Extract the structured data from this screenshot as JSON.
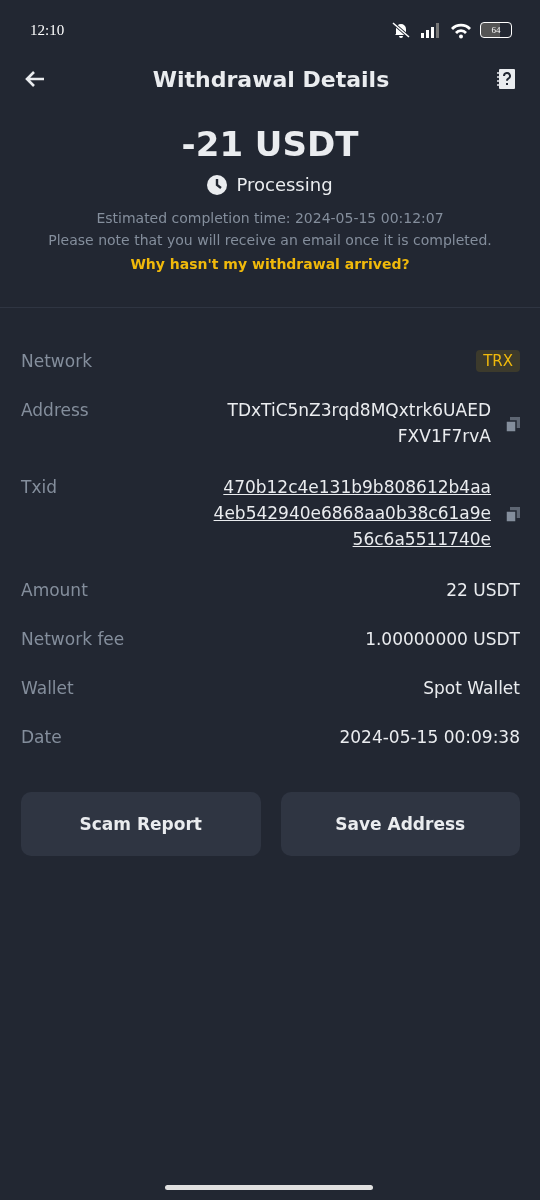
{
  "status_bar": {
    "time": "12:10",
    "battery": "64"
  },
  "header": {
    "title": "Withdrawal Details"
  },
  "summary": {
    "amount": "-21 USDT",
    "status": "Processing",
    "estimate": "Estimated completion time: 2024-05-15 00:12:07",
    "note": "Please note that you will receive an email once it is completed.",
    "help_link": "Why hasn't my withdrawal arrived?"
  },
  "details": [
    {
      "kind": "tag",
      "label": "Network",
      "lines": [
        "TRX"
      ]
    },
    {
      "kind": "copy",
      "label": "Address",
      "lines": [
        "TDxTiC5nZ3rqd8MQxtrk6UAED",
        "FXV1F7rvA"
      ]
    },
    {
      "kind": "link",
      "label": "Txid",
      "lines": [
        "470b12c4e131b9b808612b4aa",
        "4eb542940e6868aa0b38c61a9e",
        "56c6a5511740e"
      ]
    },
    {
      "kind": "plain",
      "label": "Amount",
      "lines": [
        "22 USDT"
      ]
    },
    {
      "kind": "plain",
      "label": "Network fee",
      "lines": [
        "1.00000000 USDT"
      ]
    },
    {
      "kind": "plain",
      "label": "Wallet",
      "lines": [
        "Spot Wallet"
      ]
    },
    {
      "kind": "plain",
      "label": "Date",
      "lines": [
        "2024-05-15 00:09:38"
      ]
    }
  ],
  "buttons": [
    "Scam Report",
    "Save Address"
  ]
}
